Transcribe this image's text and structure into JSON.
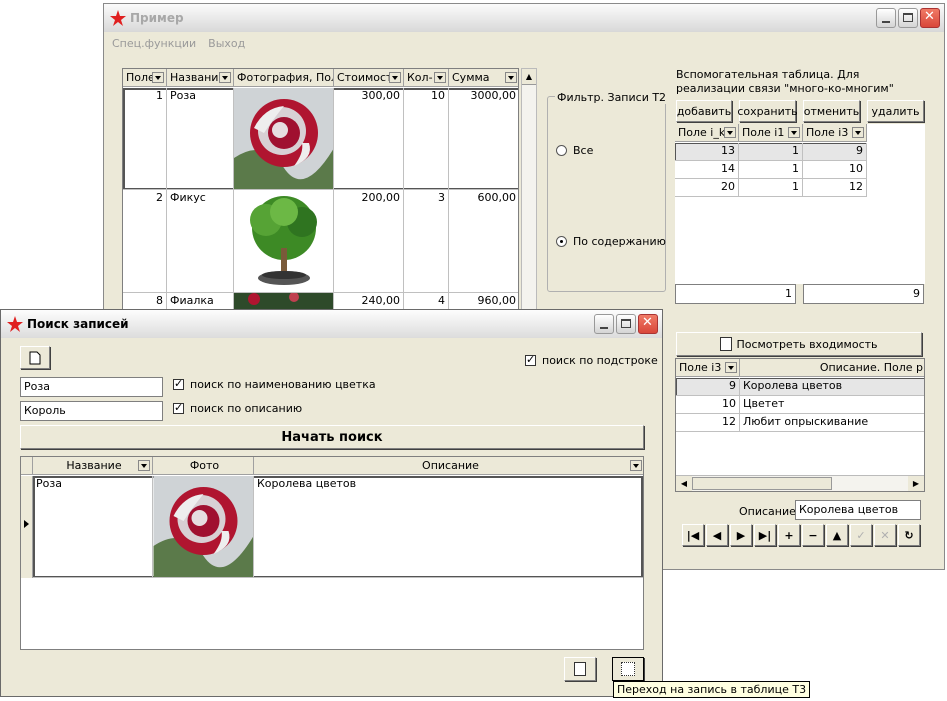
{
  "main": {
    "title": "Пример",
    "menu": [
      "Спец.функции",
      "Выход"
    ],
    "grid": {
      "headers": [
        "Поле",
        "Названи",
        "Фотография, Поле",
        "Стоимост",
        "Кол-",
        "Сумма"
      ],
      "rows": [
        {
          "id": "1",
          "name": "Роза",
          "price": "300,00",
          "qty": "10",
          "sum": "3000,00",
          "photo": "rose"
        },
        {
          "id": "2",
          "name": "Фикус",
          "price": "200,00",
          "qty": "3",
          "sum": "600,00",
          "photo": "ficus"
        },
        {
          "id": "8",
          "name": "Фиалка",
          "price": "240,00",
          "qty": "4",
          "sum": "960,00",
          "photo": "violet"
        }
      ]
    },
    "filter": {
      "label": "Фильтр. Записи Т2",
      "opt_all": "Все",
      "opt_content": "По содержанию",
      "selected": "По содержанию"
    },
    "aux": {
      "caption": "Вспомогательная таблица. Для реализации связи \"много-ко-многим\"",
      "buttons": [
        "добавить",
        "сохранить",
        "отменить",
        "удалить"
      ],
      "headers": [
        "Поле i_k",
        "Поле i1",
        "Поле i3"
      ],
      "rows": [
        [
          "13",
          "1",
          "9"
        ],
        [
          "14",
          "1",
          "10"
        ],
        [
          "20",
          "1",
          "12"
        ]
      ],
      "field1": "1",
      "field2": "9"
    },
    "view_button": "Посмотреть входимость",
    "t3": {
      "headers": [
        "Поле i3",
        "Описание. Поле р"
      ],
      "rows": [
        [
          "9",
          "Королева цветов"
        ],
        [
          "10",
          "Цветет"
        ],
        [
          "12",
          "Любит опрыскивание"
        ]
      ]
    },
    "desc_label": "Описание:",
    "desc_value": "Королева цветов",
    "nav": [
      "|◀",
      "◀",
      "▶",
      "▶|",
      "+",
      "−",
      "▲",
      "✓",
      "✕",
      "↻"
    ]
  },
  "search": {
    "title": "Поиск записей",
    "substring_label": "поиск по подстроке",
    "name_value": "Роза",
    "name_label": "поиск по наименованию цветка",
    "desc_value": "Король",
    "desc_label": "поиск по описанию",
    "start_button": "Начать поиск",
    "headers": [
      "Название",
      "Фото",
      "Описание"
    ],
    "row": {
      "name": "Роза",
      "desc": "Королева цветов"
    }
  },
  "tooltip": "Переход на запись в таблице Т3",
  "colors": {
    "title_star": "#e02020",
    "rose": "#b01530",
    "leaf": "#3d8a25",
    "selected_row": "#e6e6e6"
  }
}
